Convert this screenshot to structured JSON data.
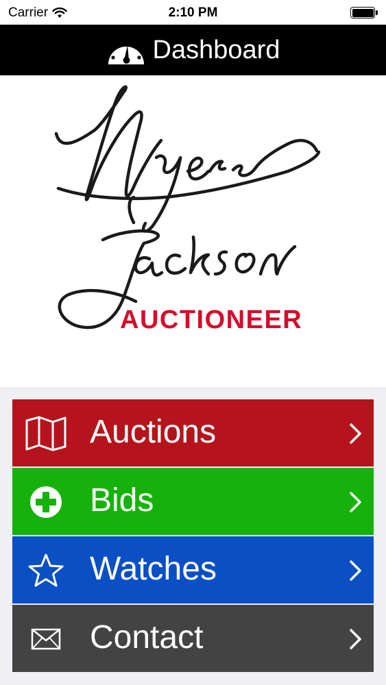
{
  "status_bar": {
    "carrier": "Carrier",
    "time": "2:10 PM"
  },
  "nav_bar": {
    "title": "Dashboard",
    "icon": "dashboard-gauge-icon"
  },
  "logo": {
    "script_text": "Myers Jackson",
    "brand_text": "AUCTIONEER",
    "brand_color": "#d50c2a"
  },
  "menu": {
    "items": [
      {
        "label": "Auctions",
        "icon": "map-icon",
        "color": "#b5141c"
      },
      {
        "label": "Bids",
        "icon": "plus-circle-icon",
        "color": "#16b20b"
      },
      {
        "label": "Watches",
        "icon": "star-icon",
        "color": "#0a4fc4"
      },
      {
        "label": "Contact",
        "icon": "envelope-icon",
        "color": "#444343"
      }
    ]
  }
}
